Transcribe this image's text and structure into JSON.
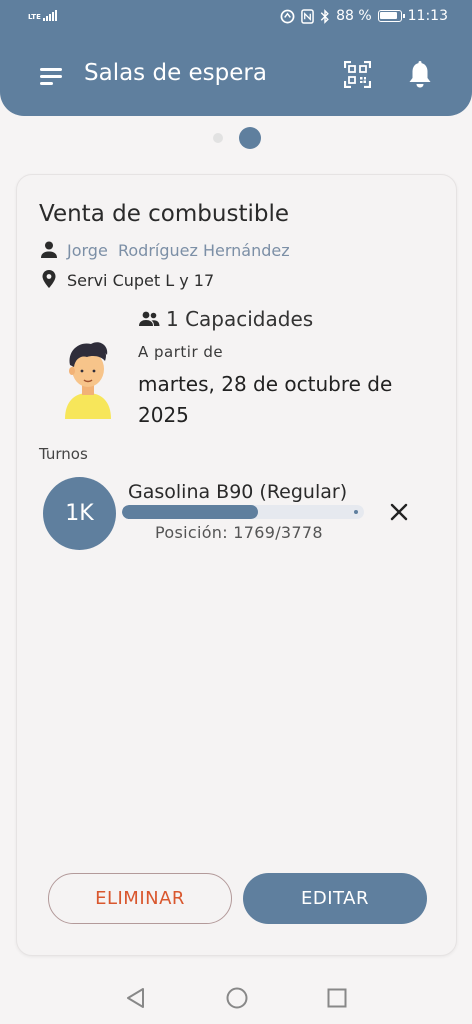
{
  "status_bar": {
    "network": "LTE",
    "battery_percent": "88 %",
    "time": "11:13"
  },
  "header": {
    "title": "Salas de espera",
    "menu_icon": "menu-icon",
    "qr_icon": "qr-code-scan-icon",
    "notifications_icon": "bell-icon",
    "background_color": "#5f7f9e"
  },
  "pager": {
    "page_count": 2,
    "active_index": 1
  },
  "room": {
    "title": "Venta de combustible",
    "owner": "Jorge  Rodríguez Hernández",
    "location": "Servi Cupet L y 17",
    "capacities": "1 Capacidades",
    "from_label": "A partir de",
    "date": "martes, 28 de octubre de 2025"
  },
  "turns": {
    "label": "Turnos",
    "items": [
      {
        "badge": "1K",
        "name": "Gasolina B90 (Regular)",
        "position_text": "Posición: 1769/3778",
        "progress_fraction": 0.56
      }
    ]
  },
  "actions": {
    "delete_label": "ELIMINAR",
    "edit_label": "EDITAR",
    "delete_color": "#d9572e",
    "accent_color": "#5f7f9e"
  },
  "system_nav": {
    "back_icon": "back-triangle-icon",
    "home_icon": "home-circle-icon",
    "recents_icon": "recents-square-icon"
  }
}
